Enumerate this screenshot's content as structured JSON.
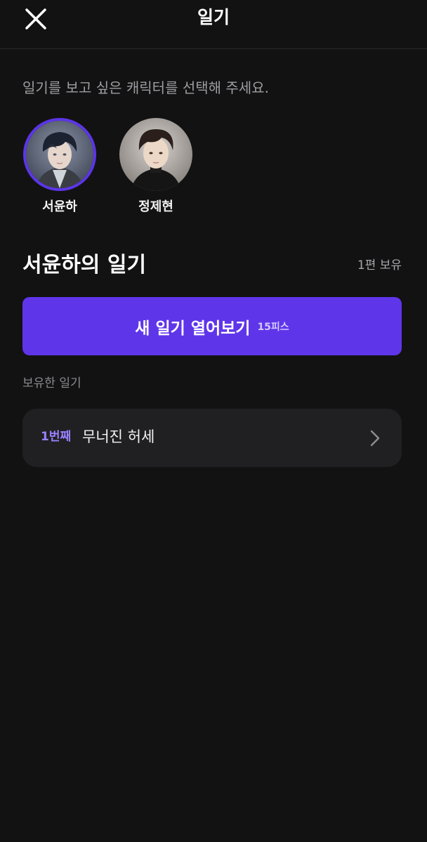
{
  "header": {
    "title": "일기",
    "close_icon": "close-icon"
  },
  "instruction": "일기를 보고 싶은 캐릭터를 선택해 주세요.",
  "characters": [
    {
      "name": "서윤하",
      "selected": true
    },
    {
      "name": "정제현",
      "selected": false
    }
  ],
  "diary_section": {
    "title": "서윤하의 일기",
    "owned_count": "1편 보유"
  },
  "open_button": {
    "label": "새 일기 열어보기",
    "cost": "15피스"
  },
  "owned_label": "보유한 일기",
  "diaries": [
    {
      "number": "1번째",
      "title": "무너진 허세"
    }
  ],
  "colors": {
    "background": "#121212",
    "accent": "#5f35ea",
    "selected_ring": "#5c35e8",
    "number_text": "#9a80ff",
    "card": "#202022"
  }
}
